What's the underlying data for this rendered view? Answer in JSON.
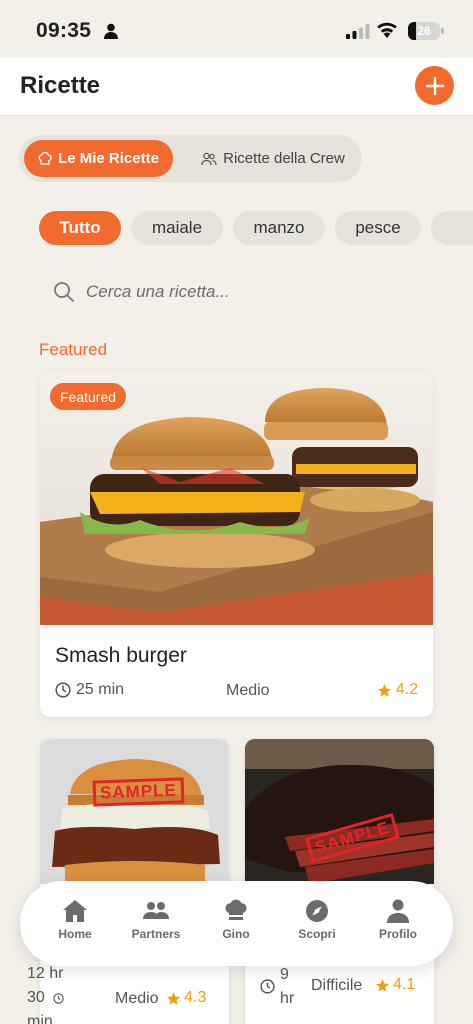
{
  "status_bar": {
    "time": "09:35",
    "battery": "26"
  },
  "header": {
    "title": "Ricette"
  },
  "segments": {
    "mine": "Le Mie Ricette",
    "crew": "Ricette della Crew"
  },
  "filters": [
    "Tutto",
    "maiale",
    "manzo",
    "pesce"
  ],
  "search": {
    "placeholder": "Cerca una ricetta..."
  },
  "featured_section": {
    "label": "Featured"
  },
  "featured_card": {
    "badge": "Featured",
    "title": "Smash burger",
    "time": "25 min",
    "difficulty": "Medio",
    "rating": "4.2"
  },
  "cards": [
    {
      "stamp": "SAMPLE",
      "time": "12 hr 30 min",
      "difficulty": "Medio",
      "rating": "4.3"
    },
    {
      "stamp": "SAMPLE",
      "time": "9 hr",
      "difficulty": "Difficile",
      "rating": "4.1"
    }
  ],
  "tabbar": {
    "home": "Home",
    "partners": "Partners",
    "gino": "Gino",
    "discover": "Scopri",
    "profile": "Profilo"
  },
  "colors": {
    "accent": "#f26a2e",
    "background": "#f3efe9",
    "rating": "#f39c12"
  }
}
